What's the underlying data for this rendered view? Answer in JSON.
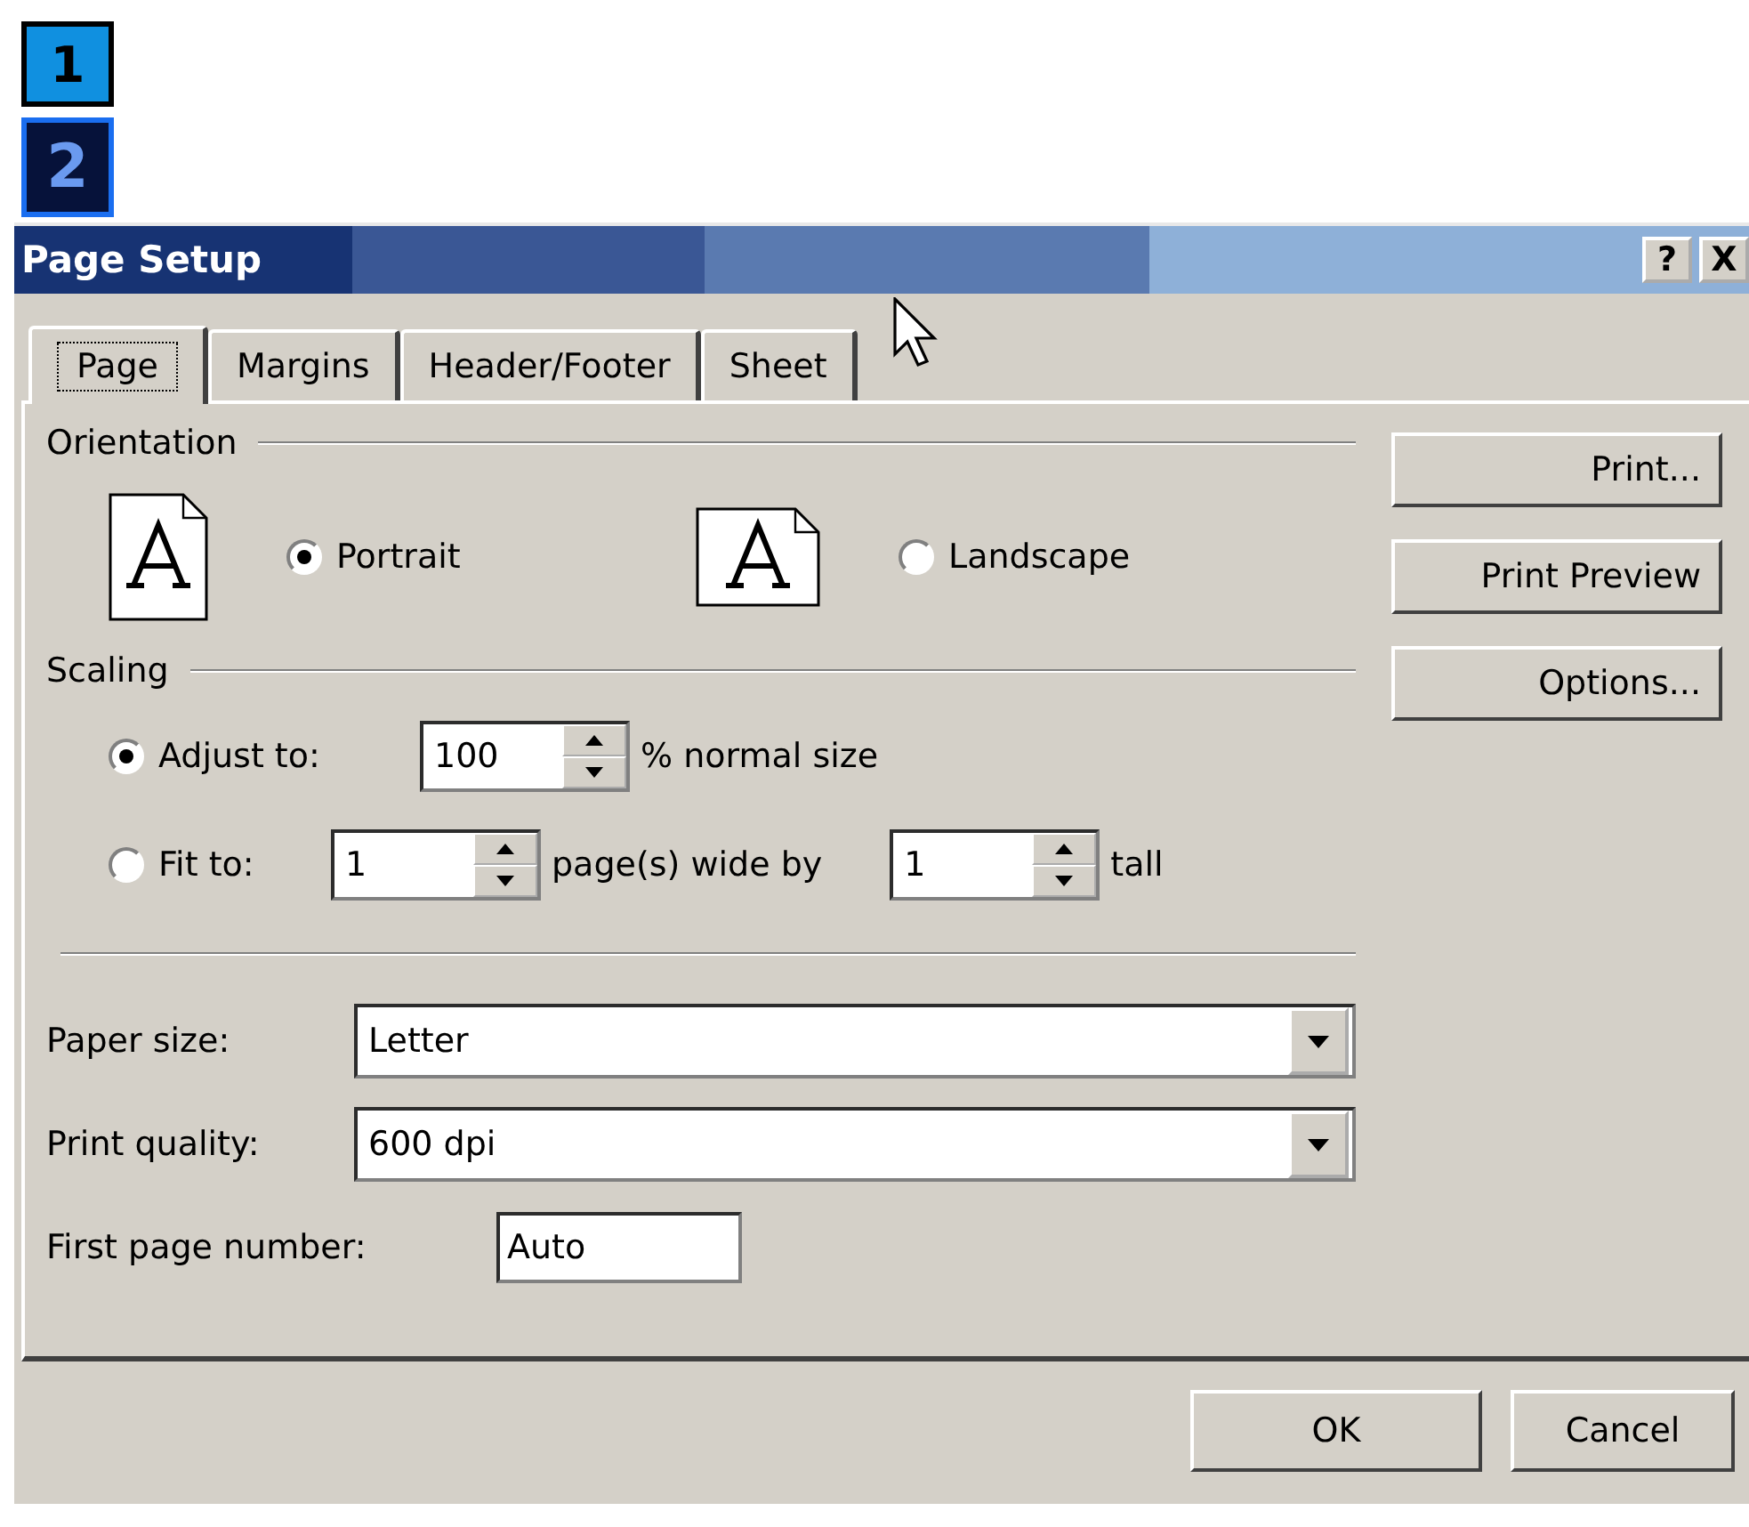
{
  "badges": [
    {
      "label": "1",
      "selected": false
    },
    {
      "label": "2",
      "selected": true
    }
  ],
  "window": {
    "title": "Page Setup",
    "buttons": [
      "?",
      "X"
    ]
  },
  "tabs": [
    {
      "label": "Page",
      "selected": true
    },
    {
      "label": "Margins",
      "selected": false
    },
    {
      "label": "Header/Footer",
      "selected": false
    },
    {
      "label": "Sheet",
      "selected": false
    }
  ],
  "orientation": {
    "label": "Orientation",
    "options": [
      {
        "label": "Portrait",
        "selected": true,
        "kind": "portrait"
      },
      {
        "label": "Landscape",
        "selected": false,
        "kind": "landscape"
      }
    ]
  },
  "scaling": {
    "label": "Scaling",
    "adjust": {
      "label": "Adjust to:",
      "selected": true,
      "value": "100",
      "suffix": "% normal size"
    },
    "fit": {
      "label": "Fit to:",
      "selected": false,
      "wide_value": "1",
      "wide_label": "page(s) wide by",
      "tall_value": "1",
      "tall_label": "tall"
    }
  },
  "paper_size": {
    "label": "Paper size:",
    "value": "Letter"
  },
  "print_quality": {
    "label": "Print quality:",
    "value": "600 dpi"
  },
  "first_page_number": {
    "label": "First page number:",
    "value": "Auto"
  },
  "side_buttons": [
    "Print...",
    "Print Preview",
    "Options..."
  ],
  "footer_buttons": [
    "OK",
    "Cancel"
  ]
}
